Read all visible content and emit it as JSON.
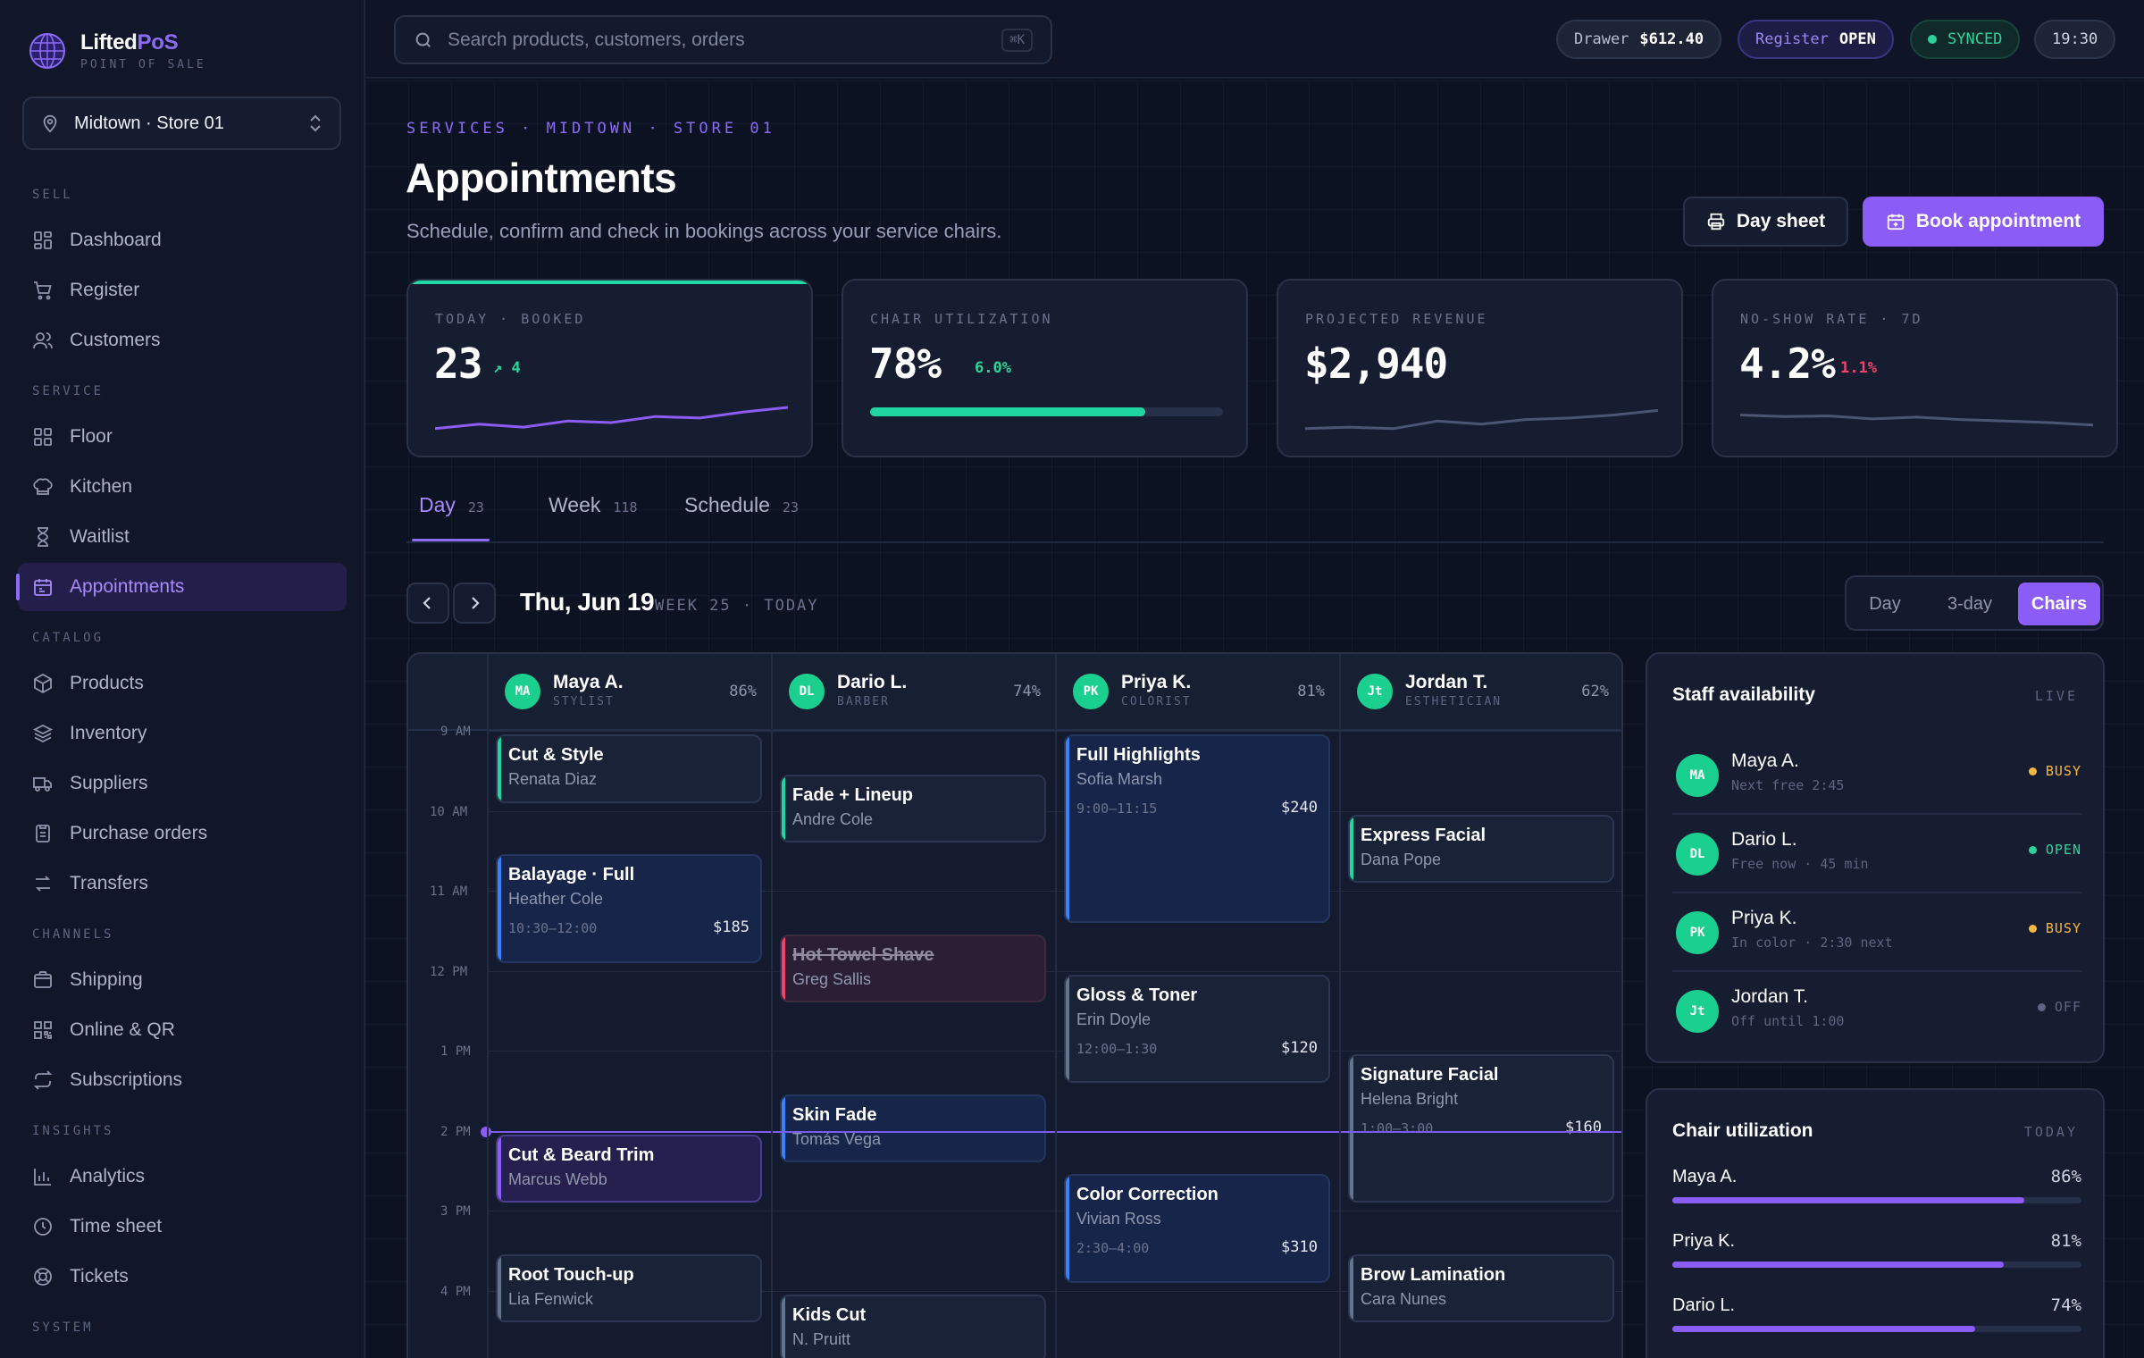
{
  "app": {
    "name_main": "Lifted",
    "name_accent": "PoS",
    "subtitle": "POINT OF SALE"
  },
  "store": {
    "label": "Midtown · Store 01"
  },
  "nav": {
    "sections": [
      {
        "label": "SELL",
        "items": [
          "Dashboard",
          "Register",
          "Customers"
        ]
      },
      {
        "label": "SERVICE",
        "items": [
          "Floor",
          "Kitchen",
          "Waitlist",
          "Appointments"
        ]
      },
      {
        "label": "CATALOG",
        "items": [
          "Products",
          "Inventory",
          "Suppliers",
          "Purchase orders",
          "Transfers"
        ]
      },
      {
        "label": "CHANNELS",
        "items": [
          "Shipping",
          "Online & QR",
          "Subscriptions"
        ]
      },
      {
        "label": "INSIGHTS",
        "items": [
          "Analytics",
          "Time sheet",
          "Tickets"
        ]
      },
      {
        "label": "SYSTEM",
        "items": []
      }
    ],
    "active": "Appointments"
  },
  "topbar": {
    "search_placeholder": "Search products, customers, orders",
    "search_kbd": "⌘K",
    "drawer_label": "Drawer",
    "drawer_value": "$612.40",
    "register_label": "Register",
    "register_value": "OPEN",
    "sync_status": "SYNCED",
    "clock": "19:30"
  },
  "page": {
    "breadcrumb": "SERVICES · MIDTOWN · STORE 01",
    "title": "Appointments",
    "subtitle": "Schedule, confirm and check in bookings across your service chairs.",
    "btn_daysheet": "Day sheet",
    "btn_book": "Book appointment"
  },
  "kpis": [
    {
      "label": "TODAY · BOOKED",
      "value": "23",
      "delta": "↗ 4",
      "delta_color": "#2fd39a",
      "spark": [
        0.3,
        0.45,
        0.35,
        0.55,
        0.5,
        0.7,
        0.65,
        0.85,
        1.0
      ]
    },
    {
      "label": "CHAIR UTILIZATION",
      "value": "78%",
      "delta": "6.0%",
      "delta_color": "#2fd39a",
      "progress": 0.78
    },
    {
      "label": "PROJECTED REVENUE",
      "value": "$2,940",
      "delta": "",
      "delta_color": "#2fd39a",
      "spark": [
        0.3,
        0.35,
        0.3,
        0.55,
        0.45,
        0.6,
        0.65,
        0.75,
        0.9
      ]
    },
    {
      "label": "NO-SHOW RATE · 7D",
      "value": "4.2%",
      "delta": "1.1%",
      "delta_color": "#f0426b",
      "spark": [
        0.75,
        0.7,
        0.72,
        0.62,
        0.68,
        0.6,
        0.55,
        0.5,
        0.42
      ]
    }
  ],
  "tabs": [
    {
      "label": "Day",
      "count": "23"
    },
    {
      "label": "Week",
      "count": "118"
    },
    {
      "label": "Schedule",
      "count": "23"
    }
  ],
  "datebar": {
    "date": "Thu, Jun 19",
    "sub": "WEEK 25 · TODAY",
    "views": [
      "Day",
      "3-day",
      "Chairs"
    ],
    "active_view": "Chairs"
  },
  "calendar": {
    "hours": [
      "9 AM",
      "10 AM",
      "11 AM",
      "12 PM",
      "1 PM",
      "2 PM",
      "3 PM",
      "4 PM"
    ],
    "now_hour": 14.0,
    "staff": [
      {
        "initials": "MA",
        "name": "Maya A.",
        "role": "STYLIST",
        "util": "86%"
      },
      {
        "initials": "DL",
        "name": "Dario L.",
        "role": "BARBER",
        "util": "74%"
      },
      {
        "initials": "PK",
        "name": "Priya K.",
        "role": "COLORIST",
        "util": "81%"
      },
      {
        "initials": "Jt",
        "name": "Jordan T.",
        "role": "ESTHETICIAN",
        "util": "62%"
      }
    ],
    "appointments": [
      {
        "col": 0,
        "start": 9.0,
        "end": 9.9,
        "title": "Cut & Style",
        "client": "Renata Diaz",
        "time": "",
        "price": "",
        "color": "#1fd6a0",
        "kind": "normal"
      },
      {
        "col": 0,
        "start": 10.5,
        "end": 11.9,
        "title": "Balayage · Full",
        "client": "Heather Cole",
        "time": "10:30–12:00",
        "price": "$185",
        "color": "#3b82f6",
        "kind": "blue"
      },
      {
        "col": 0,
        "start": 14.0,
        "end": 14.9,
        "title": "Cut & Beard Trim",
        "client": "Marcus Webb",
        "time": "",
        "price": "",
        "color": "#8b5cf6",
        "kind": "purple"
      },
      {
        "col": 0,
        "start": 15.5,
        "end": 16.4,
        "title": "Root Touch-up",
        "client": "Lia Fenwick",
        "time": "",
        "price": "",
        "color": "#64748b",
        "kind": "normal"
      },
      {
        "col": 1,
        "start": 9.5,
        "end": 10.4,
        "title": "Fade + Lineup",
        "client": "Andre Cole",
        "time": "",
        "price": "",
        "color": "#1fd6a0",
        "kind": "normal"
      },
      {
        "col": 1,
        "start": 11.5,
        "end": 12.4,
        "title": "Hot Towel Shave",
        "client": "Greg Sallis",
        "time": "",
        "price": "",
        "color": "#f0426b",
        "kind": "red"
      },
      {
        "col": 1,
        "start": 13.5,
        "end": 14.4,
        "title": "Skin Fade",
        "client": "Tomás Vega",
        "time": "",
        "price": "",
        "color": "#3b82f6",
        "kind": "blue"
      },
      {
        "col": 1,
        "start": 16.0,
        "end": 16.9,
        "title": "Kids Cut",
        "client": "N. Pruitt",
        "time": "",
        "price": "",
        "color": "#64748b",
        "kind": "normal"
      },
      {
        "col": 2,
        "start": 9.0,
        "end": 11.4,
        "title": "Full Highlights",
        "client": "Sofia Marsh",
        "time": "9:00–11:15",
        "price": "$240",
        "color": "#3b82f6",
        "kind": "blue"
      },
      {
        "col": 2,
        "start": 12.0,
        "end": 13.4,
        "title": "Gloss & Toner",
        "client": "Erin Doyle",
        "time": "12:00–1:30",
        "price": "$120",
        "color": "#64748b",
        "kind": "normal"
      },
      {
        "col": 2,
        "start": 14.5,
        "end": 15.9,
        "title": "Color Correction",
        "client": "Vivian Ross",
        "time": "2:30–4:00",
        "price": "$310",
        "color": "#3b82f6",
        "kind": "blue"
      },
      {
        "col": 3,
        "start": 10.0,
        "end": 10.9,
        "title": "Express Facial",
        "client": "Dana Pope",
        "time": "",
        "price": "",
        "color": "#1fd6a0",
        "kind": "normal"
      },
      {
        "col": 3,
        "start": 13.0,
        "end": 14.9,
        "title": "Signature Facial",
        "client": "Helena Bright",
        "time": "1:00–3:00",
        "price": "$160",
        "color": "#64748b",
        "kind": "normal"
      },
      {
        "col": 3,
        "start": 15.5,
        "end": 16.4,
        "title": "Brow Lamination",
        "client": "Cara Nunes",
        "time": "",
        "price": "",
        "color": "#64748b",
        "kind": "normal"
      }
    ]
  },
  "availability": {
    "title": "Staff availability",
    "tag": "LIVE",
    "rows": [
      {
        "initials": "MA",
        "name": "Maya A.",
        "sub": "Next free 2:45",
        "status": "BUSY",
        "color": "#f5b83d"
      },
      {
        "initials": "DL",
        "name": "Dario L.",
        "sub": "Free now · 45 min",
        "status": "OPEN",
        "color": "#2fd39a"
      },
      {
        "initials": "PK",
        "name": "Priya K.",
        "sub": "In color · 2:30 next",
        "status": "BUSY",
        "color": "#f5b83d"
      },
      {
        "initials": "Jt",
        "name": "Jordan T.",
        "sub": "Off until 1:00",
        "status": "OFF",
        "color": "#5d6580"
      }
    ]
  },
  "utilization": {
    "title": "Chair utilization",
    "tag": "TODAY",
    "rows": [
      {
        "name": "Maya A.",
        "pct": "86%",
        "value": 0.86
      },
      {
        "name": "Priya K.",
        "pct": "81%",
        "value": 0.81
      },
      {
        "name": "Dario L.",
        "pct": "74%",
        "value": 0.74
      }
    ]
  }
}
